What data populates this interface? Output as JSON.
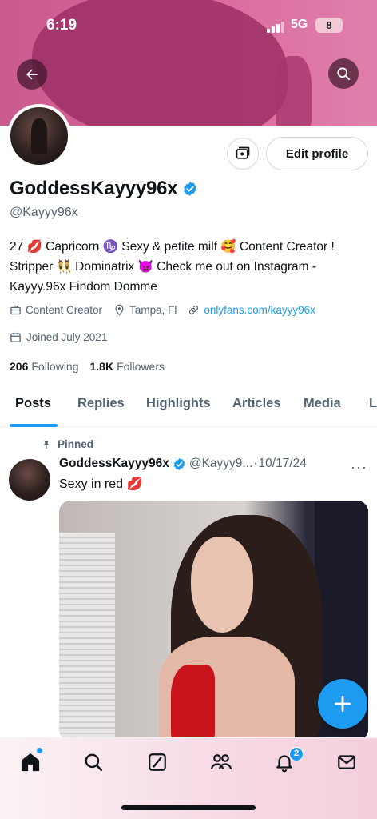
{
  "status_bar": {
    "time": "6:19",
    "network": "5G",
    "battery": "8"
  },
  "profile": {
    "display_name": "GoddessKayyy96x",
    "handle": "@Kayyy96x",
    "bio": "27 💋 Capricorn ♑ Sexy & petite milf 🥰 Content Creator ! Stripper 👯 Dominatrix 😈 Check me out on Instagram - Kayyy.96x Findom Domme",
    "category": "Content Creator",
    "location": "Tampa, Fl",
    "website": "onlyfans.com/kayyy96x",
    "joined": "Joined July 2021",
    "following_count": "206",
    "following_label": "Following",
    "followers_count": "1.8K",
    "followers_label": "Followers",
    "edit_label": "Edit profile"
  },
  "tabs": [
    {
      "label": "Posts",
      "active": true
    },
    {
      "label": "Replies"
    },
    {
      "label": "Highlights"
    },
    {
      "label": "Articles"
    },
    {
      "label": "Media"
    },
    {
      "label": "L"
    }
  ],
  "post": {
    "pinned_label": "Pinned",
    "author": "GoddessKayyy96x",
    "handle": "@Kayyy9...",
    "date": "10/17/24",
    "separator": "·",
    "more": "···",
    "text": "Sexy in red 💋"
  },
  "bottom_nav": {
    "items": [
      "home-icon",
      "search-icon",
      "grok-icon",
      "communities-icon",
      "notifications-icon",
      "messages-icon"
    ],
    "notification_count": "2"
  },
  "colors": {
    "accent": "#1d9bf0",
    "banner": "#d9679b",
    "text": "#0f1419",
    "secondary": "#536471"
  }
}
